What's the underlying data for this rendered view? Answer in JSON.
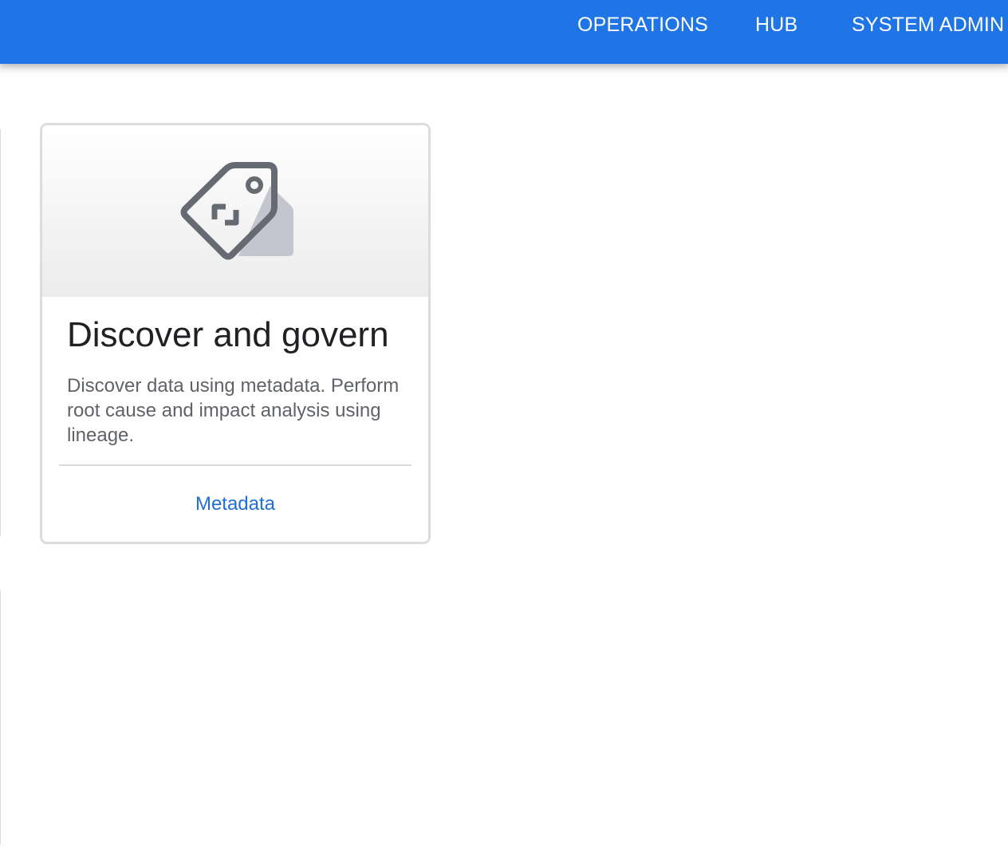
{
  "topbar": {
    "nav": [
      {
        "label": "OPERATIONS"
      },
      {
        "label": "HUB"
      },
      {
        "label": "SYSTEM ADMIN"
      }
    ],
    "background_color": "#1f75e6"
  },
  "card": {
    "icon": "tag-icon",
    "title": "Discover and govern",
    "description": "Discover data using metadata. Perform root cause and impact analysis using lineage.",
    "link_label": "Metadata",
    "link_color": "#1f6fd6"
  }
}
